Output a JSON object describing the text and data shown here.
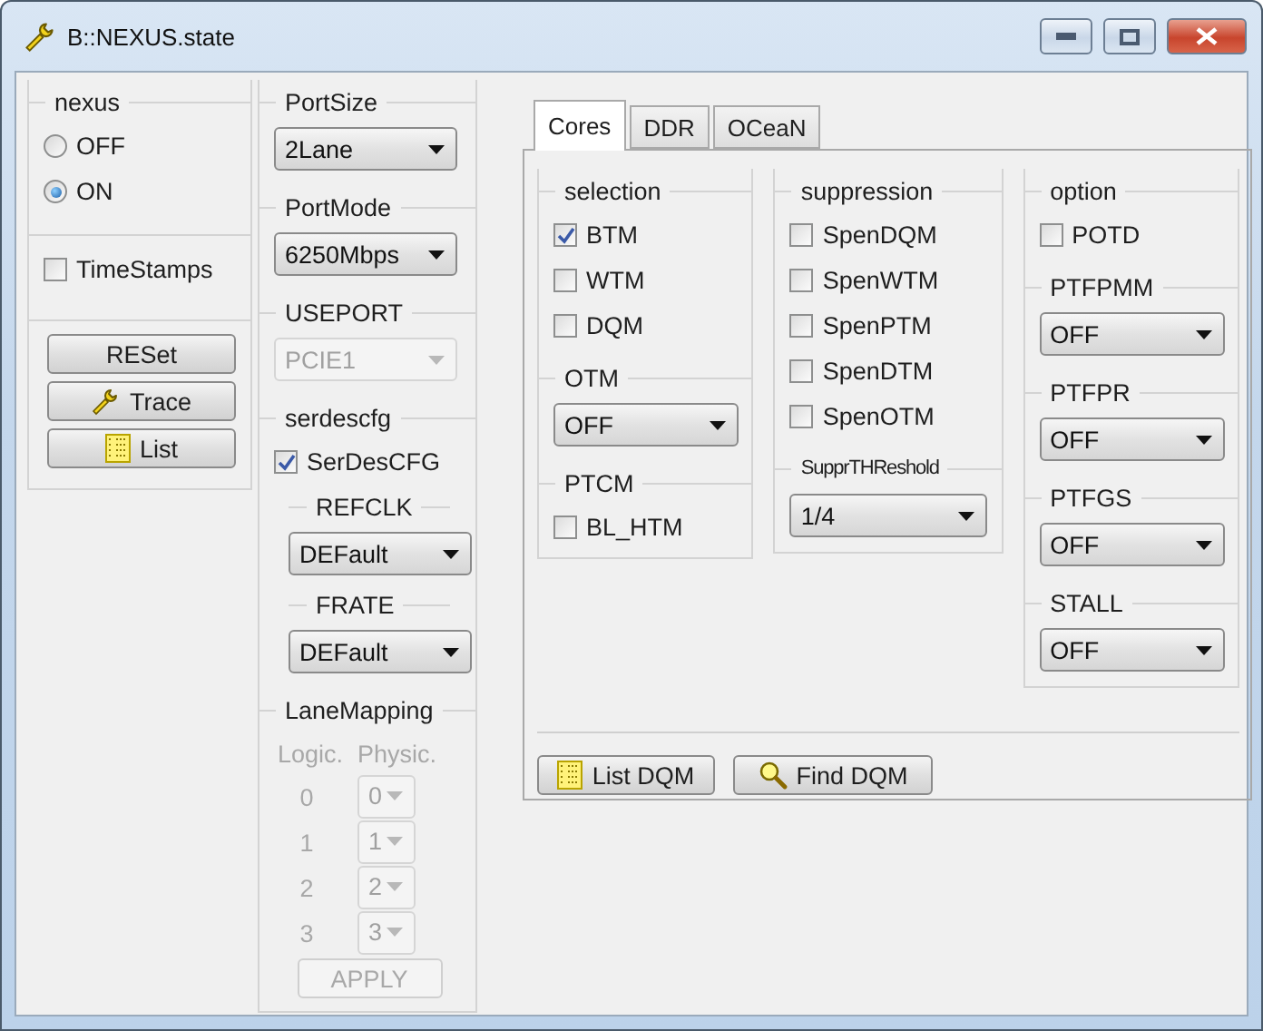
{
  "window": {
    "title": "B::NEXUS.state"
  },
  "left_column": [
    {
      "title": "nexus",
      "items": [
        {
          "kind": "radio",
          "label": "OFF",
          "selected": false
        },
        {
          "kind": "radio",
          "label": "ON",
          "selected": true
        }
      ]
    },
    {
      "items": [
        {
          "kind": "checkbox",
          "label": "TimeStamps",
          "checked": false
        }
      ]
    },
    {
      "items": [
        {
          "kind": "button",
          "label": "RESet",
          "disabled": false
        },
        {
          "kind": "button",
          "label": "Trace",
          "disabled": false
        },
        {
          "kind": "button",
          "label": "List",
          "disabled": false
        }
      ]
    }
  ],
  "port_column": [
    {
      "title": "PortSize",
      "items": [
        {
          "kind": "dropdown",
          "value": "2Lane",
          "disabled": false
        }
      ]
    },
    {
      "title": "PortMode",
      "items": [
        {
          "kind": "dropdown",
          "value": "6250Mbps",
          "disabled": false
        }
      ]
    },
    {
      "title": "USEPORT",
      "items": [
        {
          "kind": "dropdown",
          "value": "PCIE1",
          "disabled": true
        }
      ]
    },
    {
      "title": "serdescfg",
      "items": [
        {
          "kind": "checkbox",
          "label": "SerDesCFG",
          "checked": true
        },
        {
          "kind": "subsection",
          "title": "REFCLK",
          "items": [
            {
              "kind": "dropdown",
              "value": "DEFault",
              "disabled": false
            }
          ]
        },
        {
          "kind": "subsection",
          "title": "FRATE",
          "items": [
            {
              "kind": "dropdown",
              "value": "DEFault",
              "disabled": false
            }
          ]
        }
      ]
    },
    {
      "title": "LaneMapping",
      "items": [
        {
          "kind": "lanemap",
          "headers": [
            "Logic.",
            "Physic."
          ],
          "disabled": true,
          "rows": [
            {
              "logical": "0",
              "physical": "0"
            },
            {
              "logical": "1",
              "physical": "1"
            },
            {
              "logical": "2",
              "physical": "2"
            },
            {
              "logical": "3",
              "physical": "3"
            }
          ]
        },
        {
          "kind": "button",
          "label": "APPLY",
          "disabled": true
        }
      ]
    }
  ],
  "tabs": [
    {
      "label": "Cores",
      "selected": true
    },
    {
      "label": "DDR",
      "selected": false
    },
    {
      "label": "OCeaN",
      "selected": false
    }
  ],
  "cores_groups": [
    [
      {
        "title": "selection",
        "items": [
          {
            "kind": "checkbox",
            "label": "BTM",
            "checked": true
          },
          {
            "kind": "checkbox",
            "label": "WTM",
            "checked": false
          },
          {
            "kind": "checkbox",
            "label": "DQM",
            "checked": false
          }
        ]
      },
      {
        "title": "OTM",
        "items": [
          {
            "kind": "dropdown",
            "value": "OFF",
            "disabled": false
          }
        ]
      },
      {
        "title": "PTCM",
        "items": [
          {
            "kind": "checkbox",
            "label": "BL_HTM",
            "checked": false
          }
        ]
      }
    ],
    [
      {
        "title": "suppression",
        "items": [
          {
            "kind": "checkbox",
            "label": "SpenDQM",
            "checked": false
          },
          {
            "kind": "checkbox",
            "label": "SpenWTM",
            "checked": false
          },
          {
            "kind": "checkbox",
            "label": "SpenPTM",
            "checked": false
          },
          {
            "kind": "checkbox",
            "label": "SpenDTM",
            "checked": false
          },
          {
            "kind": "checkbox",
            "label": "SpenOTM",
            "checked": false
          }
        ]
      },
      {
        "title": "SupprTHReshold",
        "items": [
          {
            "kind": "dropdown",
            "value": "1/4",
            "disabled": false
          }
        ]
      }
    ],
    [
      {
        "title": "option",
        "items": [
          {
            "kind": "checkbox",
            "label": "POTD",
            "checked": false
          }
        ]
      },
      {
        "title": "PTFPMM",
        "items": [
          {
            "kind": "dropdown",
            "value": "OFF",
            "disabled": false
          }
        ]
      },
      {
        "title": "PTFPR",
        "items": [
          {
            "kind": "dropdown",
            "value": "OFF",
            "disabled": false
          }
        ]
      },
      {
        "title": "PTFGS",
        "items": [
          {
            "kind": "dropdown",
            "value": "OFF",
            "disabled": false
          }
        ]
      },
      {
        "title": "STALL",
        "items": [
          {
            "kind": "dropdown",
            "value": "OFF",
            "disabled": false
          }
        ]
      }
    ]
  ],
  "bottom_buttons": [
    {
      "label": "List DQM"
    },
    {
      "label": "Find DQM"
    }
  ]
}
